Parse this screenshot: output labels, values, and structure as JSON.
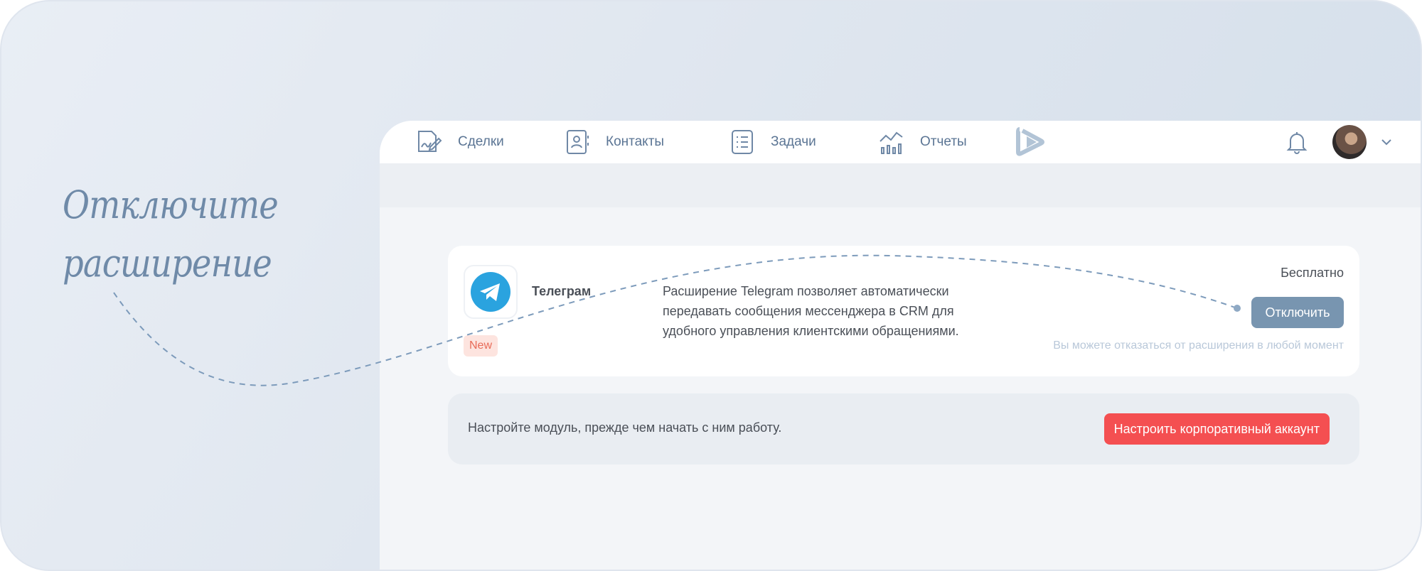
{
  "hint": {
    "line1": "Отключите",
    "line2": "расширение"
  },
  "nav": {
    "items": [
      {
        "label": "Сделки",
        "icon": "deals-icon"
      },
      {
        "label": "Контакты",
        "icon": "contacts-icon"
      },
      {
        "label": "Задачи",
        "icon": "tasks-icon"
      },
      {
        "label": "Отчеты",
        "icon": "reports-icon"
      }
    ],
    "logo_icon": "play-logo-icon",
    "notifications_icon": "bell-icon",
    "avatar_icon": "avatar",
    "dropdown_icon": "chevron-down-icon"
  },
  "extension": {
    "name": "Телеграм",
    "badge": "New",
    "description": "Расширение Telegram позволяет автоматически передавать сообщения мессенджера в CRM для удобного управления клиентскими обращениями.",
    "price": "Бесплатно",
    "disable_label": "Отключить",
    "cancel_note": "Вы можете отказаться от расширения в любой момент",
    "logo_icon": "telegram-icon"
  },
  "setup": {
    "text": "Настройте модуль, прежде чем начать с ним работу.",
    "button_label": "Настроить корпоративный аккаунт"
  },
  "colors": {
    "accent_red": "#f44f51",
    "disable_button": "#7895b0",
    "telegram_blue": "#2aa3df",
    "nav_text": "#5b7594"
  }
}
